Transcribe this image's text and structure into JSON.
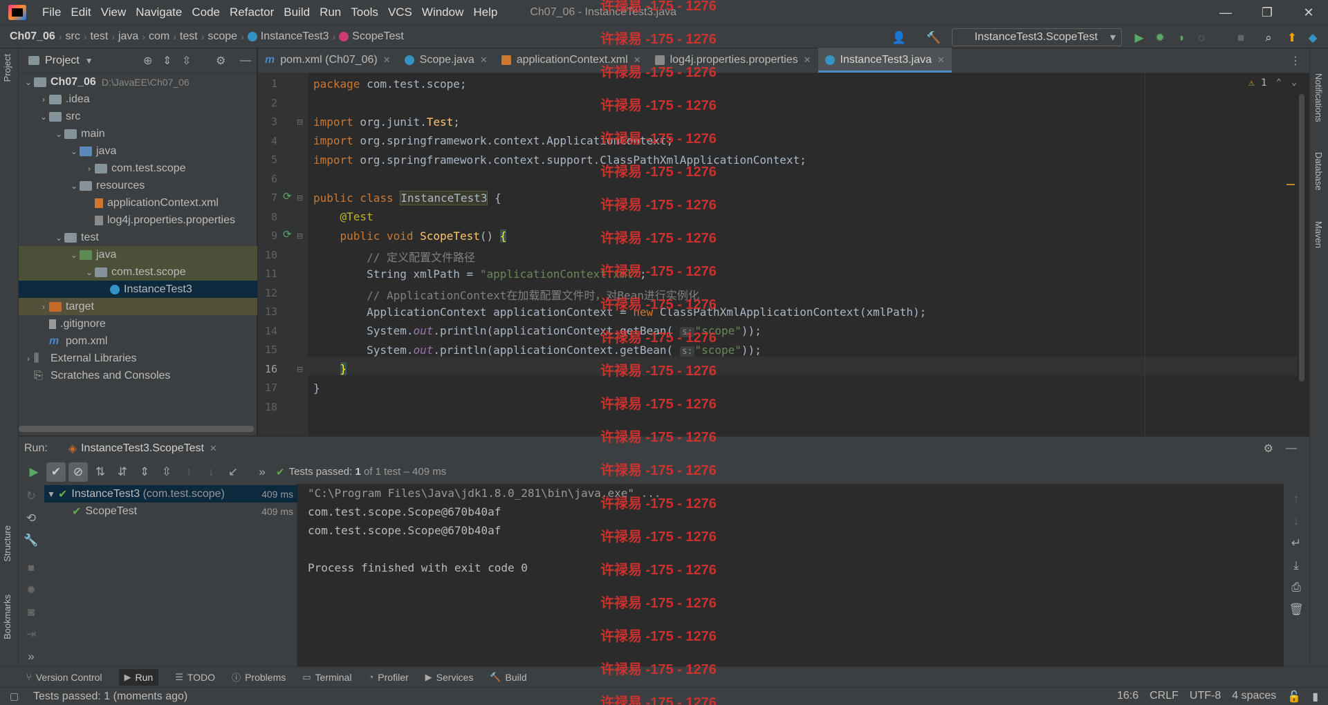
{
  "menubar": {
    "items": [
      "File",
      "Edit",
      "View",
      "Navigate",
      "Code",
      "Refactor",
      "Build",
      "Run",
      "Tools",
      "VCS",
      "Window",
      "Help"
    ],
    "window_title": "Ch07_06 - InstanceTest3.java"
  },
  "breadcrumb": [
    "Ch07_06",
    "src",
    "test",
    "java",
    "com",
    "test",
    "scope",
    "InstanceTest3",
    "ScopeTest"
  ],
  "run_config": "InstanceTest3.ScopeTest",
  "left_stripe": {
    "project": "Project",
    "structure": "Structure",
    "bookmarks": "Bookmarks"
  },
  "right_stripe": {
    "notifications": "Notifications",
    "database": "Database",
    "maven": "Maven"
  },
  "project_panel": {
    "title": "Project",
    "tree": [
      {
        "label": "Ch07_06",
        "path": "D:\\JavaEE\\Ch07_06",
        "indent": 0,
        "arrow": "down",
        "icon": "folder"
      },
      {
        "label": ".idea",
        "indent": 1,
        "arrow": "right",
        "icon": "folder"
      },
      {
        "label": "src",
        "indent": 1,
        "arrow": "down",
        "icon": "folder"
      },
      {
        "label": "main",
        "indent": 2,
        "arrow": "down",
        "icon": "folder"
      },
      {
        "label": "java",
        "indent": 3,
        "arrow": "down",
        "icon": "folder-blue"
      },
      {
        "label": "com.test.scope",
        "indent": 4,
        "arrow": "right",
        "icon": "package"
      },
      {
        "label": "resources",
        "indent": 3,
        "arrow": "down",
        "icon": "folder"
      },
      {
        "label": "applicationContext.xml",
        "indent": 4,
        "arrow": "none",
        "icon": "xml"
      },
      {
        "label": "log4j.properties.properties",
        "indent": 4,
        "arrow": "none",
        "icon": "properties"
      },
      {
        "label": "test",
        "indent": 2,
        "arrow": "down",
        "icon": "folder"
      },
      {
        "label": "java",
        "indent": 3,
        "arrow": "down",
        "icon": "folder-green"
      },
      {
        "label": "com.test.scope",
        "indent": 4,
        "arrow": "down",
        "icon": "package"
      },
      {
        "label": "InstanceTest3",
        "indent": 5,
        "arrow": "none",
        "icon": "class"
      },
      {
        "label": "target",
        "indent": 1,
        "arrow": "right",
        "icon": "folder-orange"
      },
      {
        "label": ".gitignore",
        "indent": 1,
        "arrow": "none",
        "icon": "file"
      },
      {
        "label": "pom.xml",
        "indent": 1,
        "arrow": "none",
        "icon": "maven"
      },
      {
        "label": "External Libraries",
        "indent": 0,
        "arrow": "right",
        "icon": "library"
      },
      {
        "label": "Scratches and Consoles",
        "indent": 0,
        "arrow": "none",
        "icon": "scratch"
      }
    ]
  },
  "editor_tabs": [
    {
      "label": "pom.xml (Ch07_06)",
      "icon": "maven"
    },
    {
      "label": "Scope.java",
      "icon": "class"
    },
    {
      "label": "applicationContext.xml",
      "icon": "xml"
    },
    {
      "label": "log4j.properties.properties",
      "icon": "properties"
    },
    {
      "label": "InstanceTest3.java",
      "icon": "class",
      "active": true
    }
  ],
  "editor": {
    "warning_count": "1",
    "line_numbers": [
      "1",
      "2",
      "3",
      "4",
      "5",
      "6",
      "7",
      "8",
      "9",
      "10",
      "11",
      "12",
      "13",
      "14",
      "15",
      "16",
      "17",
      "18"
    ],
    "current_line": "16",
    "code": {
      "l1_kw": "package",
      "l1_rest": " com.test.scope;",
      "l3_kw": "import",
      "l3_a": " org.junit.",
      "l3_b": "Test",
      "l3_c": ";",
      "l4_kw": "import",
      "l4_rest": " org.springframework.context.ApplicationContext;",
      "l5_kw": "import",
      "l5_rest": " org.springframework.context.support.ClassPathXmlApplicationContext;",
      "l7_kw": "public class",
      "l7_cls": "InstanceTest3",
      "l7_rest": " {",
      "l8_ann": "@Test",
      "l9_kw": "public void",
      "l9_fn": "ScopeTest",
      "l9_a": "() ",
      "l9_brace": "{",
      "l10_cm": "// 定义配置文件路径",
      "l11_a": "String xmlPath = ",
      "l11_str": "\"applicationContext.xml\"",
      "l11_b": ";",
      "l12_cm": "// ApplicationContext在加载配置文件时，对Bean进行实例化",
      "l13_a": "ApplicationContext applicationContext = ",
      "l13_kw": "new",
      "l13_b": " ClassPathXmlApplicationContext(xmlPath);",
      "l14_a": "System.",
      "l14_it": "out",
      "l14_b": ".println(applicationContext.getBean( ",
      "l14_hint": "s:",
      "l14_str": "\"scope\"",
      "l14_c": "));",
      "l15_a": "System.",
      "l15_it": "out",
      "l15_b": ".println(applicationContext.getBean( ",
      "l15_hint": "s:",
      "l15_str": "\"scope\"",
      "l15_c": "));",
      "l16": "}",
      "l17": "}"
    }
  },
  "run_panel": {
    "label": "Run:",
    "tab": "InstanceTest3.ScopeTest",
    "status_prefix": "Tests passed:",
    "status_count": "1",
    "status_suffix": "of 1 test – 409 ms",
    "tests": [
      {
        "name": "InstanceTest3",
        "pkg": "(com.test.scope)",
        "duration": "409 ms"
      },
      {
        "name": "ScopeTest",
        "duration": "409 ms"
      }
    ],
    "console": [
      "\"C:\\Program Files\\Java\\jdk1.8.0_281\\bin\\java.exe\" ...",
      "com.test.scope.Scope@670b40af",
      "com.test.scope.Scope@670b40af",
      "",
      "Process finished with exit code 0"
    ]
  },
  "bottom_tabs": [
    "Version Control",
    "Run",
    "TODO",
    "Problems",
    "Terminal",
    "Profiler",
    "Services",
    "Build"
  ],
  "status_bar": {
    "message": "Tests passed: 1 (moments ago)",
    "position": "16:6",
    "line_sep": "CRLF",
    "encoding": "UTF-8",
    "indent": "4 spaces"
  },
  "watermark": "许禄易 -175 - 1276",
  "colors": {
    "accent": "#4a88c7",
    "pass": "#5fa84d",
    "watermark": "#d6322f"
  }
}
